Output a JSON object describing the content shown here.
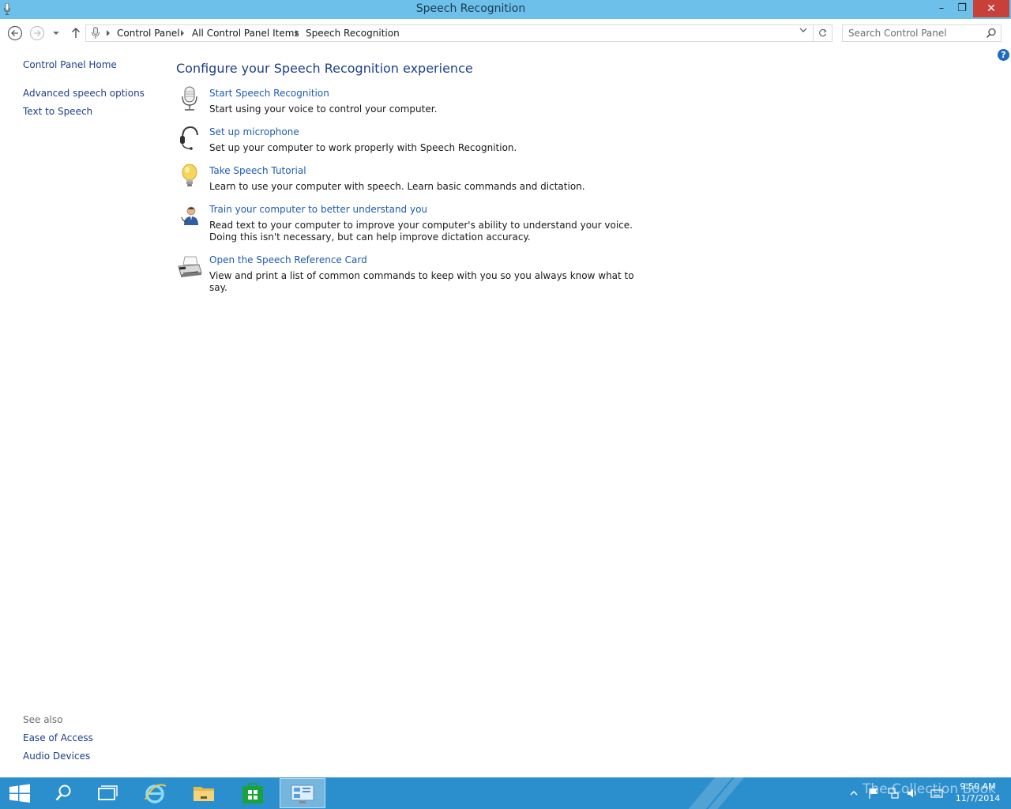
{
  "window": {
    "title": "Speech Recognition",
    "minimize_label": "–",
    "maximize_label": "❐",
    "close_label": "✕"
  },
  "navigation": {
    "breadcrumbs": [
      "Control Panel",
      "All Control Panel Items",
      "Speech Recognition"
    ],
    "search_placeholder": "Search Control Panel"
  },
  "help_label": "?",
  "left_pane": {
    "links": [
      "Control Panel Home",
      "Advanced speech options",
      "Text to Speech"
    ],
    "see_also_title": "See also",
    "see_also_links": [
      "Ease of Access",
      "Audio Devices"
    ]
  },
  "main": {
    "heading": "Configure your Speech Recognition experience",
    "tasks": [
      {
        "title": "Start Speech Recognition",
        "description": "Start using your voice to control your computer.",
        "icon": "microphone-icon"
      },
      {
        "title": "Set up microphone",
        "description": "Set up your computer to work properly with Speech Recognition.",
        "icon": "headset-icon"
      },
      {
        "title": "Take Speech Tutorial",
        "description": "Learn to use your computer with speech.  Learn basic commands and dictation.",
        "icon": "lightbulb-icon"
      },
      {
        "title": "Train your computer to better understand you",
        "description": "Read text to your computer to improve your computer's ability to understand your voice.  Doing this isn't necessary, but can help improve dictation accuracy.",
        "icon": "user-icon"
      },
      {
        "title": "Open the Speech Reference Card",
        "description": "View and print a list of common commands to keep with you so you always know what to say.",
        "icon": "printer-icon"
      }
    ]
  },
  "taskbar": {
    "clock_time": "9:50 AM",
    "clock_date": "11/7/2014",
    "watermark": "The Collection Book"
  },
  "colors": {
    "titlebar": "#6cc0ea",
    "link": "#1e5ab4",
    "heading": "#1e3f8c",
    "taskbar": "#2b8fcd",
    "close_button": "#c7413a"
  }
}
